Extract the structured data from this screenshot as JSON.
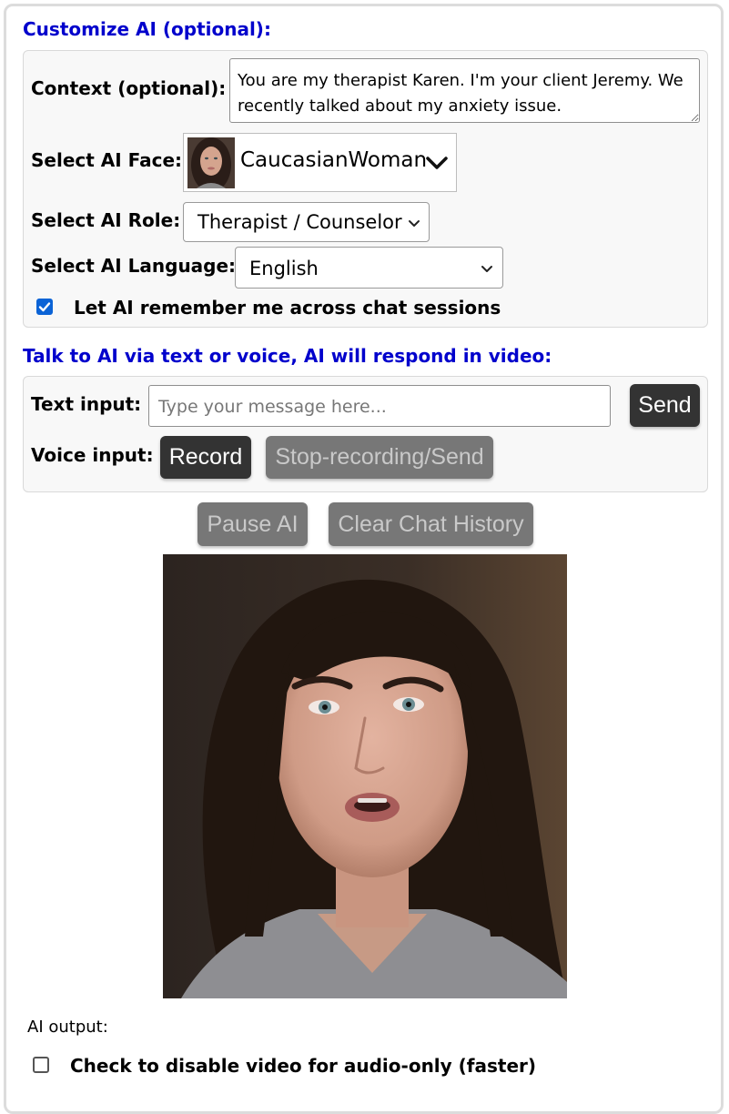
{
  "customize": {
    "heading": "Customize AI (optional):",
    "context_label": "Context (optional):",
    "context_value": "You are my therapist Karen. I'm your client Jeremy. We recently talked about my anxiety issue.",
    "face_label": "Select AI Face:",
    "face_value": "CaucasianWoman",
    "role_label": "Select AI Role:",
    "role_value": "Therapist / Counselor",
    "language_label": "Select AI Language:",
    "language_value": "English",
    "remember_label": "Let AI remember me across chat sessions",
    "remember_checked": true
  },
  "talk": {
    "heading": "Talk to AI via text or voice, AI will respond in video:",
    "text_label": "Text input:",
    "text_placeholder": "Type your message here...",
    "send_label": "Send",
    "voice_label": "Voice input:",
    "record_label": "Record",
    "stop_label": "Stop-recording/Send"
  },
  "controls": {
    "pause_label": "Pause AI",
    "clear_label": "Clear Chat History"
  },
  "output": {
    "label": "AI output:",
    "disable_video_label": "Check to disable video for audio-only (faster)",
    "disable_video_checked": false
  },
  "colors": {
    "heading": "#0000cc",
    "button_dark": "#333333",
    "button_disabled": "#777777",
    "checkbox": "#0b63d6"
  }
}
